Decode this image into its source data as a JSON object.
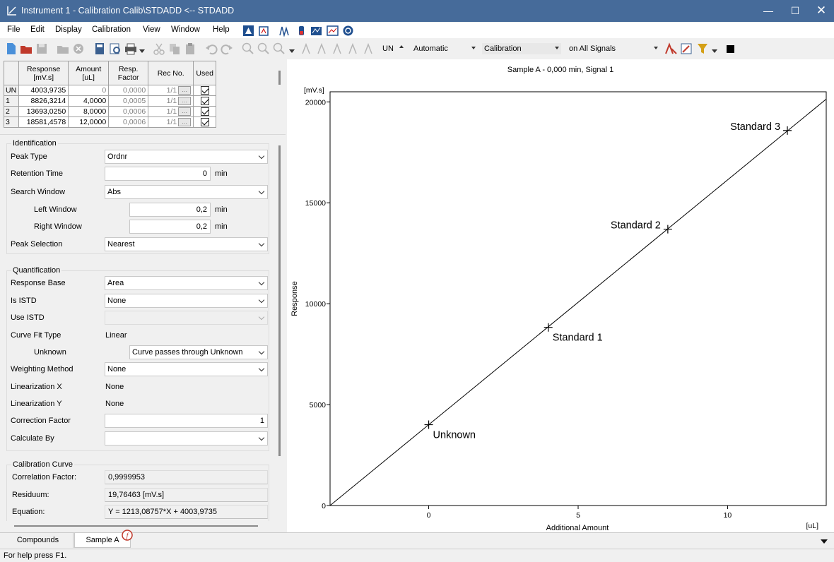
{
  "window": {
    "title": "Instrument 1 - Calibration Calib\\STDADD <-- STDADD"
  },
  "menu": [
    "File",
    "Edit",
    "Display",
    "Calibration",
    "View",
    "Window",
    "Help"
  ],
  "toolbar": {
    "unit_select": "UN",
    "mode_select": "Automatic",
    "view_select": "Calibration",
    "signal_select": "on All Signals"
  },
  "table": {
    "headers": [
      "Response\n[mV.s]",
      "Amount\n[uL]",
      "Resp.\nFactor",
      "Rec No.",
      "Used"
    ],
    "rows": [
      {
        "id": "UN",
        "response": "4003,9735",
        "amount": "0",
        "factor": "0,0000",
        "rec": "1/1"
      },
      {
        "id": "1",
        "response": "8826,3214",
        "amount": "4,0000",
        "factor": "0,0005",
        "rec": "1/1"
      },
      {
        "id": "2",
        "response": "13693,0250",
        "amount": "8,0000",
        "factor": "0,0006",
        "rec": "1/1"
      },
      {
        "id": "3",
        "response": "18581,4578",
        "amount": "12,0000",
        "factor": "0,0006",
        "rec": "1/1"
      }
    ],
    "dots": "..."
  },
  "identification": {
    "title": "Identification",
    "peak_type_label": "Peak Type",
    "peak_type": "Ordnr",
    "retention_label": "Retention Time",
    "retention": "0",
    "retention_unit": "min",
    "search_window_label": "Search Window",
    "search_window": "Abs",
    "left_window_label": "Left Window",
    "left_window": "0,2",
    "left_unit": "min",
    "right_window_label": "Right Window",
    "right_window": "0,2",
    "right_unit": "min",
    "peak_sel_label": "Peak Selection",
    "peak_sel": "Nearest"
  },
  "quantification": {
    "title": "Quantification",
    "response_base_label": "Response Base",
    "response_base": "Area",
    "is_istd_label": "Is ISTD",
    "is_istd": "None",
    "use_istd_label": "Use ISTD",
    "use_istd": "",
    "curve_fit_label": "Curve Fit Type",
    "curve_fit": "Linear",
    "unknown_label": "Unknown",
    "unknown": "Curve passes through Unknown",
    "weighting_label": "Weighting Method",
    "weighting": "None",
    "lin_x_label": "Linearization X",
    "lin_x": "None",
    "lin_y_label": "Linearization Y",
    "lin_y": "None",
    "corr_factor_label": "Correction Factor",
    "corr_factor": "1",
    "calc_by_label": "Calculate By",
    "calc_by": ""
  },
  "calibration_curve": {
    "title": "Calibration Curve",
    "corr_label": "Correlation Factor:",
    "corr": "0,9999953",
    "residuum_label": "Residuum:",
    "residuum": "19,76463 [mV.s]",
    "equation_label": "Equation:",
    "equation": "Y = 1213,08757*X + 4003,9735"
  },
  "tabs": [
    "Compounds",
    "Sample A"
  ],
  "status": "For help press F1.",
  "chart_data": {
    "type": "scatter",
    "title": "Sample A - 0,000 min, Signal 1",
    "xlabel": "Additional Amount",
    "ylabel": "Response",
    "x_unit": "[uL]",
    "y_unit": "[mV.s]",
    "xlim": [
      -3.3,
      13.3
    ],
    "ylim": [
      0,
      20500
    ],
    "xticks": [
      0,
      5,
      10
    ],
    "yticks": [
      0,
      5000,
      10000,
      15000,
      20000
    ],
    "points": [
      {
        "label": "Unknown",
        "x": 0,
        "y": 4003.9735
      },
      {
        "label": "Standard 1",
        "x": 4,
        "y": 8826.3214
      },
      {
        "label": "Standard 2",
        "x": 8,
        "y": 13693.025
      },
      {
        "label": "Standard 3",
        "x": 12,
        "y": 18581.4578
      }
    ],
    "fit": {
      "slope": 1213.08757,
      "intercept": 4003.9735
    }
  }
}
